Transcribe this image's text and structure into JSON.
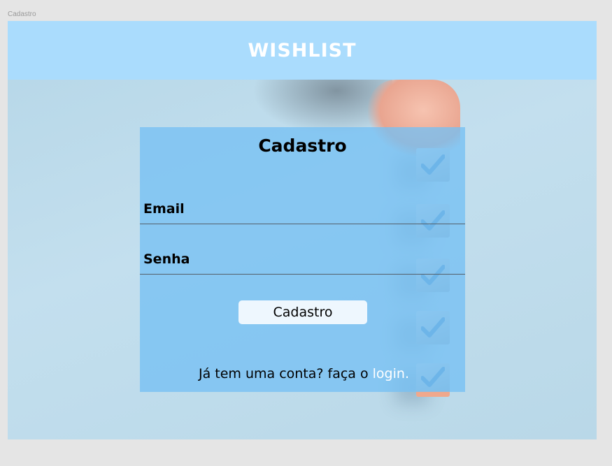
{
  "frame": {
    "label": "Cadastro"
  },
  "header": {
    "title": "WISHLIST"
  },
  "form": {
    "title": "Cadastro",
    "email_label": "Email",
    "password_label": "Senha",
    "submit_label": "Cadastro",
    "login_prompt": "Já tem uma conta? faça o ",
    "login_link": "login",
    "login_suffix": "."
  },
  "colors": {
    "header_bg": "#aadcfd",
    "panel_bg": "#76c0f4",
    "button_bg": "#eef7fe",
    "link": "#ffffff"
  },
  "icons": [
    "checkmark-icon"
  ]
}
